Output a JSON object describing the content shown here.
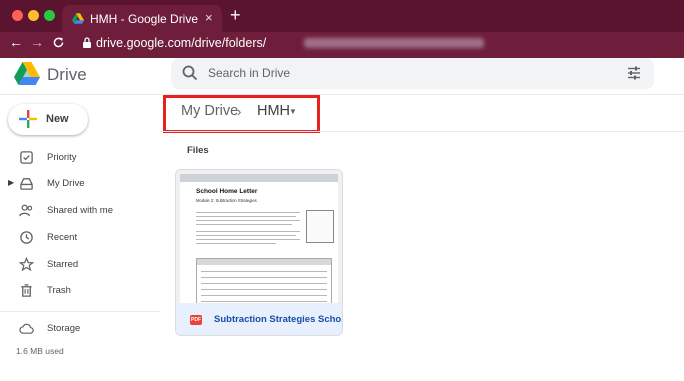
{
  "browser": {
    "tab_title": "HMH - Google Drive",
    "tab_close": "×",
    "new_tab": "+",
    "url": "drive.google.com/drive/folders/",
    "back": "←",
    "forward": "→",
    "reload": "C"
  },
  "header": {
    "app_name": "Drive",
    "search_placeholder": "Search in Drive"
  },
  "sidebar": {
    "new_label": "New",
    "items": [
      {
        "label": "Priority",
        "icon": "priority-icon"
      },
      {
        "label": "My Drive",
        "icon": "my-drive-icon"
      },
      {
        "label": "Shared with me",
        "icon": "shared-icon"
      },
      {
        "label": "Recent",
        "icon": "clock-icon"
      },
      {
        "label": "Starred",
        "icon": "star-icon"
      },
      {
        "label": "Trash",
        "icon": "trash-icon"
      }
    ],
    "storage_label": "Storage",
    "storage_used": "1.6 MB used"
  },
  "breadcrumb": {
    "root": "My Drive",
    "separator": "›",
    "folder": "HMH"
  },
  "main": {
    "files_heading": "Files",
    "files": [
      {
        "name": "Subtraction Strategies Scho...",
        "type_badge": "PDF",
        "thumb_title": "School Home Letter",
        "thumb_subtitle": "Module 2: Subtraction Strategies"
      }
    ]
  },
  "colors": {
    "chrome": "#6e1e3a",
    "highlight_box": "#e8201e",
    "selected_file_bg": "#e8f0fe",
    "file_name": "#174ea6"
  }
}
